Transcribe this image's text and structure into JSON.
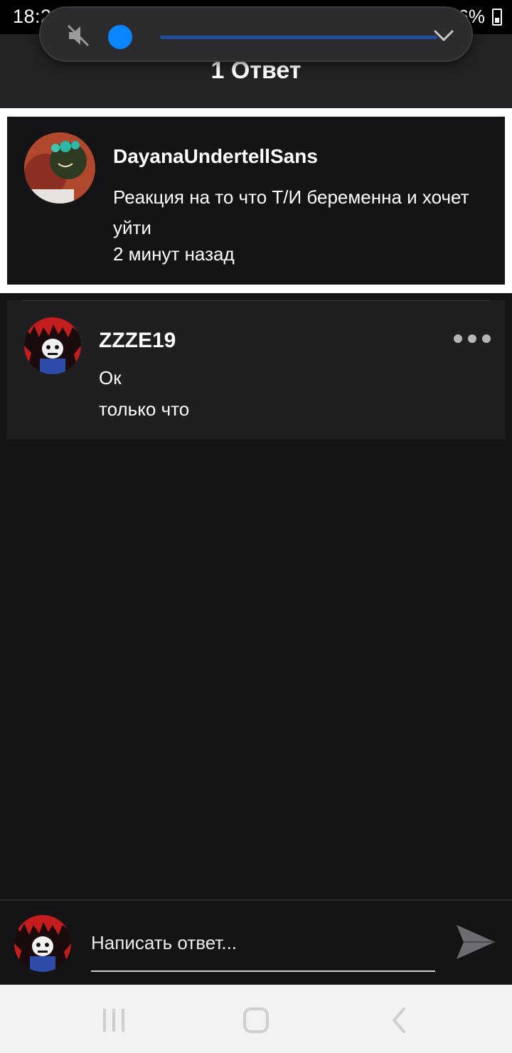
{
  "status_bar": {
    "time": "18:23",
    "battery": "36%",
    "icons": [
      "youtube-icon",
      "vk-icon",
      "alarm-icon",
      "mute-icon",
      "wifi-icon",
      "signal-icon",
      "signal-icon",
      "battery-charging-icon"
    ]
  },
  "header": {
    "title": "1 Ответ"
  },
  "volume_panel": {
    "level": 0.0,
    "accent_color": "#0a84ff"
  },
  "parent_comment": {
    "author": "DayanaUndertellSans",
    "text": "Реакция на то что Т/И беременна и хочет уйти",
    "time": "2 минут назад"
  },
  "replies": [
    {
      "author": "ZZZE19",
      "text": "Ок",
      "time": "только что"
    }
  ],
  "composer": {
    "placeholder": "Написать ответ..."
  },
  "colors": {
    "background": "#141316",
    "card": "#1f1e21",
    "accent": "#0a84ff"
  }
}
